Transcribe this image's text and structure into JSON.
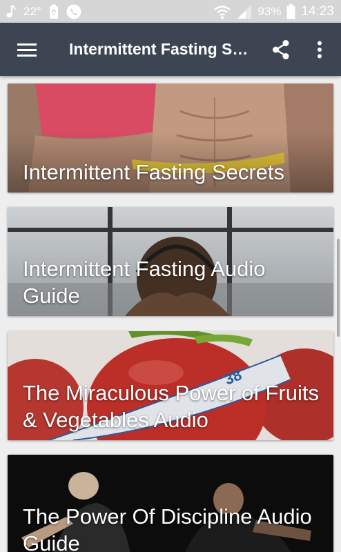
{
  "status_bar": {
    "temperature": "22°",
    "battery": "93%",
    "time": "14:23",
    "icons": [
      "music-note-icon",
      "recycle-icon",
      "phone-icon",
      "wifi-icon",
      "signal-icon",
      "battery-icon"
    ]
  },
  "app_bar": {
    "title": "Intermittent Fasting Secrets",
    "background": "#3d4452",
    "icons": [
      "menu-icon",
      "share-icon",
      "more-vert-icon"
    ]
  },
  "cards": [
    {
      "title": "Intermittent Fasting Secrets",
      "image": "fitness-couple-abs-photo"
    },
    {
      "title": "Intermittent Fasting Audio Guide",
      "image": "woman-headphones-window-photo"
    },
    {
      "title": "The Miraculous Power of Fruits & Vegetables Audio",
      "image": "apple-measuring-tape-photo"
    },
    {
      "title": "The Power Of Discipline Audio Guide",
      "image": "people-doing-pushups-photo"
    }
  ]
}
